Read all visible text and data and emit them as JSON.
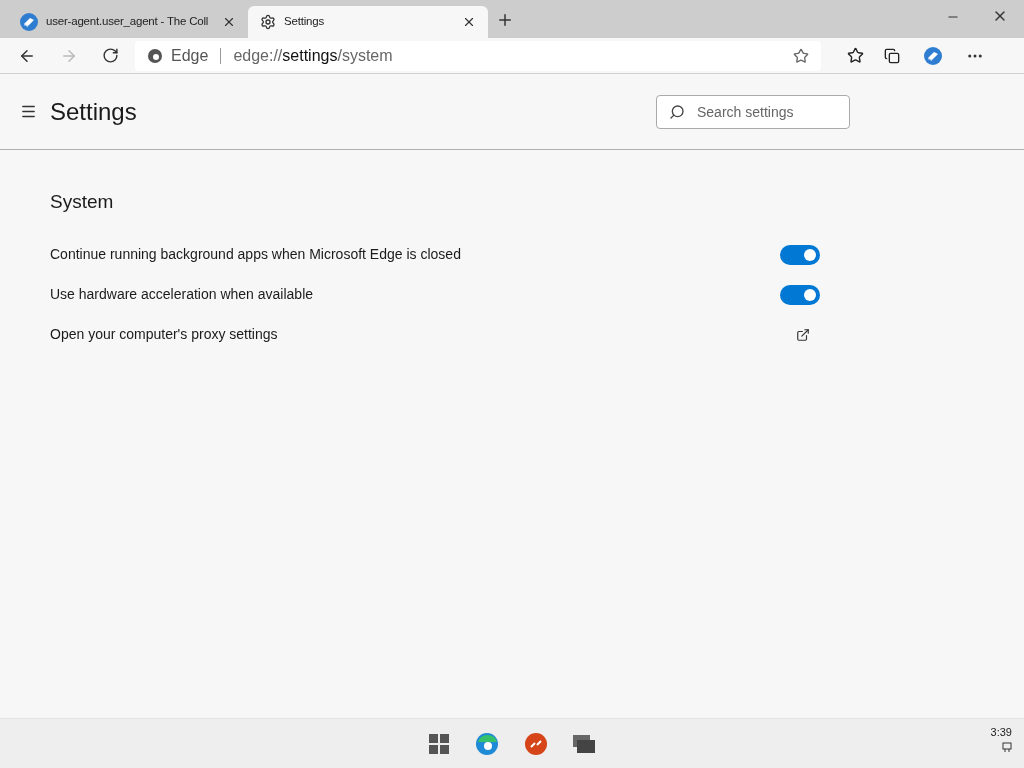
{
  "tabs": [
    {
      "title": "user-agent.user_agent - The Coll",
      "kind": "site",
      "selected": false
    },
    {
      "title": "Settings",
      "kind": "settings",
      "selected": true
    }
  ],
  "address": {
    "site_label": "Edge",
    "url_prefix": "edge://",
    "url_host": "settings",
    "url_path": "/system"
  },
  "header": {
    "title": "Settings",
    "search": {
      "placeholder": "Search settings"
    }
  },
  "section": {
    "title": "System",
    "items": [
      {
        "label": "Continue running background apps when Microsoft Edge is closed",
        "kind": "toggle",
        "on": true
      },
      {
        "label": "Use hardware acceleration when available",
        "kind": "toggle",
        "on": true
      },
      {
        "label": "Open your computer's proxy settings",
        "kind": "external"
      }
    ]
  },
  "taskbar": {
    "clock": "3:39"
  }
}
